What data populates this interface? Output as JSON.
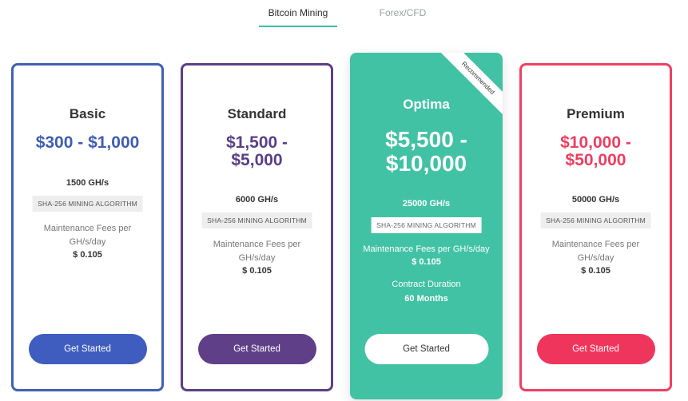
{
  "tabs": {
    "bitcoin_label": "Bitcoin Mining",
    "forex_label": "Forex/CFD"
  },
  "plans": {
    "basic": {
      "name": "Basic",
      "price": "$300 - $1,000",
      "hashrate": "1500 GH/s",
      "algorithm": "SHA-256 MINING ALGORITHM",
      "fees_line1": "Maintenance Fees per",
      "fees_line2": "GH/s/day",
      "fee_value": "$ 0.105",
      "button": "Get Started"
    },
    "standard": {
      "name": "Standard",
      "price_line1": "$1,500 -",
      "price_line2": "$5,000",
      "hashrate": "6000 GH/s",
      "algorithm": "SHA-256 MINING ALGORITHM",
      "fees_line1": "Maintenance Fees per",
      "fees_line2": "GH/s/day",
      "fee_value": "$ 0.105",
      "button": "Get Started"
    },
    "optima": {
      "ribbon": "Recommended",
      "name": "Optima",
      "price_line1": "$5,500 -",
      "price_line2": "$10,000",
      "hashrate": "25000 GH/s",
      "algorithm": "SHA-256 MINING ALGORITHM",
      "fees": "Maintenance Fees per GH/s/day",
      "fee_value": "$ 0.105",
      "duration_label": "Contract Duration",
      "duration_value": "60 Months",
      "button": "Get Started"
    },
    "premium": {
      "name": "Premium",
      "price_line1": "$10,000 -",
      "price_line2": "$50,000",
      "hashrate": "50000 GH/s",
      "algorithm": "SHA-256 MINING ALGORITHM",
      "fees_line1": "Maintenance Fees per",
      "fees_line2": "GH/s/day",
      "fee_value": "$ 0.105",
      "button": "Get Started"
    }
  },
  "colors": {
    "accent": "#42c2a4",
    "basic": "#3f5cbf",
    "standard": "#5f4088",
    "premium": "#f0355c"
  }
}
